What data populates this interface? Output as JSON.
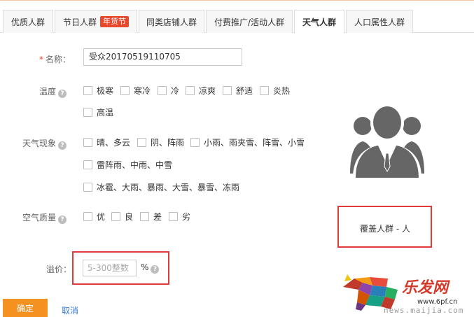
{
  "tabs": [
    {
      "label": "优质人群",
      "active": false
    },
    {
      "label": "节日人群",
      "badge": "年货节",
      "active": false
    },
    {
      "label": "同类店铺人群",
      "active": false
    },
    {
      "label": "付费推广/活动人群",
      "active": false
    },
    {
      "label": "天气人群",
      "active": true
    },
    {
      "label": "人口属性人群",
      "active": false
    }
  ],
  "form": {
    "name_label": "名称：",
    "name_required_mark": "*",
    "name_value": "受众20170519110705",
    "temperature_label": "温度",
    "temperature_options": [
      "极寒",
      "寒冷",
      "冷",
      "凉爽",
      "舒适",
      "炎热",
      "高温"
    ],
    "weather_label": "天气现象",
    "weather_options": [
      "晴、多云",
      "阴、阵雨",
      "小雨、雨夹雪、阵雪、小雪",
      "雷阵雨、中雨、中雪",
      "冰雹、大雨、暴雨、大雪、暴雪、冻雨"
    ],
    "air_label": "空气质量",
    "air_options": [
      "优",
      "良",
      "差",
      "劣"
    ],
    "premium_label": "溢价：",
    "premium_placeholder": "5-300整数",
    "premium_unit": "%",
    "help_glyph": "?"
  },
  "coverage_text": "覆盖人群 - 人",
  "buttons": {
    "confirm": "确定",
    "cancel": "取消"
  },
  "watermark": {
    "brand": "乐发网",
    "site": "www.6pf.cn",
    "news": "news.maijia.com"
  },
  "colors": {
    "accent": "#f39121",
    "badge": "#e8492d",
    "highlight_box": "#e23a3a",
    "link": "#3b7bd4"
  }
}
